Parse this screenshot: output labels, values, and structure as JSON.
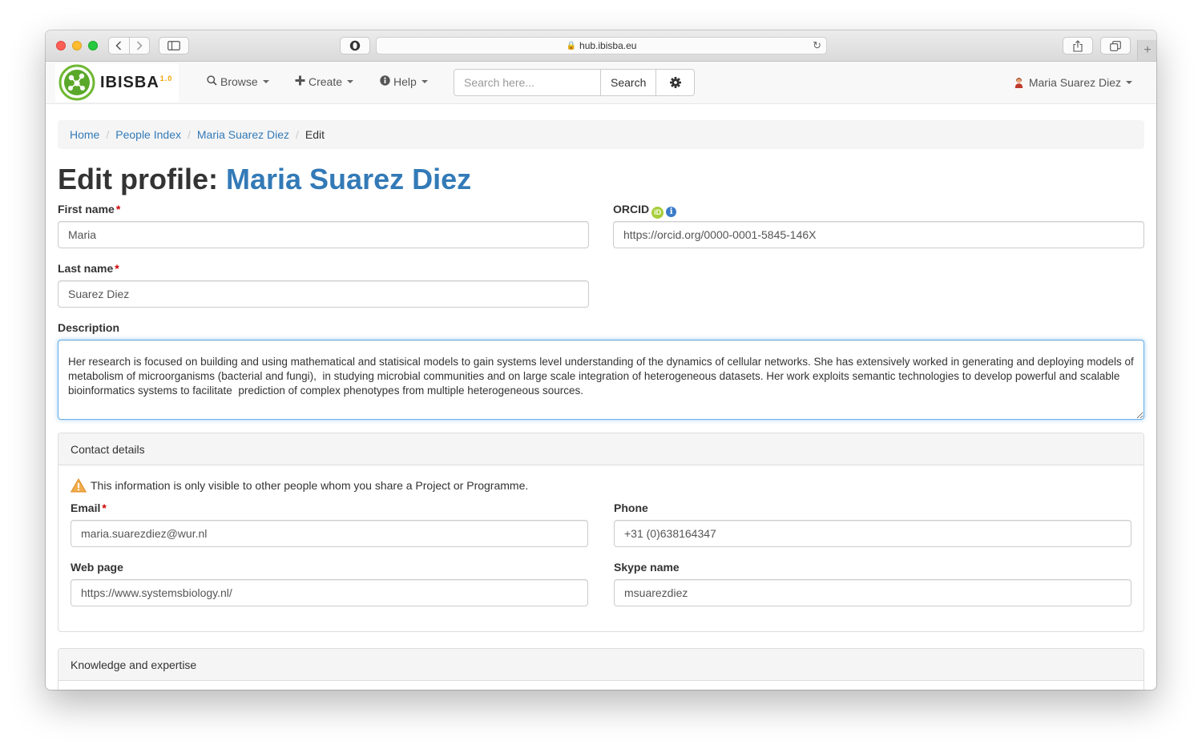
{
  "browser": {
    "url": "hub.ibisba.eu"
  },
  "navbar": {
    "brand": "IBISBA",
    "brand_version": "1.0",
    "browse_label": "Browse",
    "create_label": "Create",
    "help_label": "Help",
    "search_placeholder": "Search here...",
    "search_button": "Search",
    "user_name": "Maria Suarez Diez"
  },
  "breadcrumb": {
    "home": "Home",
    "people_index": "People Index",
    "person": "Maria Suarez Diez",
    "current": "Edit"
  },
  "page": {
    "title_prefix": "Edit profile: ",
    "title_name": "Maria Suarez Diez"
  },
  "form": {
    "first_name_label": "First name",
    "first_name_value": "Maria",
    "last_name_label": "Last name",
    "last_name_value": "Suarez Diez",
    "orcid_label": "ORCID",
    "orcid_badge": "iD",
    "orcid_value": "https://orcid.org/0000-0001-5845-146X",
    "required_marker": "*",
    "description_label": "Description",
    "description_value": "Her research is focused on building and using mathematical and statisical models to gain systems level understanding of the dynamics of cellular networks. She has extensively worked in generating and deploying models of metabolism of microorganisms (bacterial and fungi),  in studying microbial communities and on large scale integration of heterogeneous datasets. Her work exploits semantic technologies to develop powerful and scalable bioinformatics systems to facilitate  prediction of complex phenotypes from multiple heterogeneous sources."
  },
  "contact": {
    "heading": "Contact details",
    "notice": "This information is only visible to other people whom you share a Project or Programme.",
    "email_label": "Email",
    "email_value": "maria.suarezdiez@wur.nl",
    "phone_label": "Phone",
    "phone_value": "+31 (0)638164347",
    "web_label": "Web page",
    "web_value": "https://www.systemsbiology.nl/",
    "skype_label": "Skype name",
    "skype_value": "msuarezdiez"
  },
  "knowledge": {
    "heading": "Knowledge and expertise"
  },
  "colors": {
    "link_blue": "#337ab7",
    "required_red": "#cc0000",
    "orcid_green": "#a6ce39",
    "warning_orange": "#f0ad4e"
  },
  "icons": [
    "search-icon",
    "plus-icon",
    "info-circle-icon",
    "gear-icon",
    "user-avatar-icon",
    "orcid-icon",
    "info-icon",
    "warning-icon",
    "lock-icon",
    "reload-icon",
    "share-icon",
    "tabs-icon",
    "sidebar-icon",
    "shield-icon"
  ]
}
